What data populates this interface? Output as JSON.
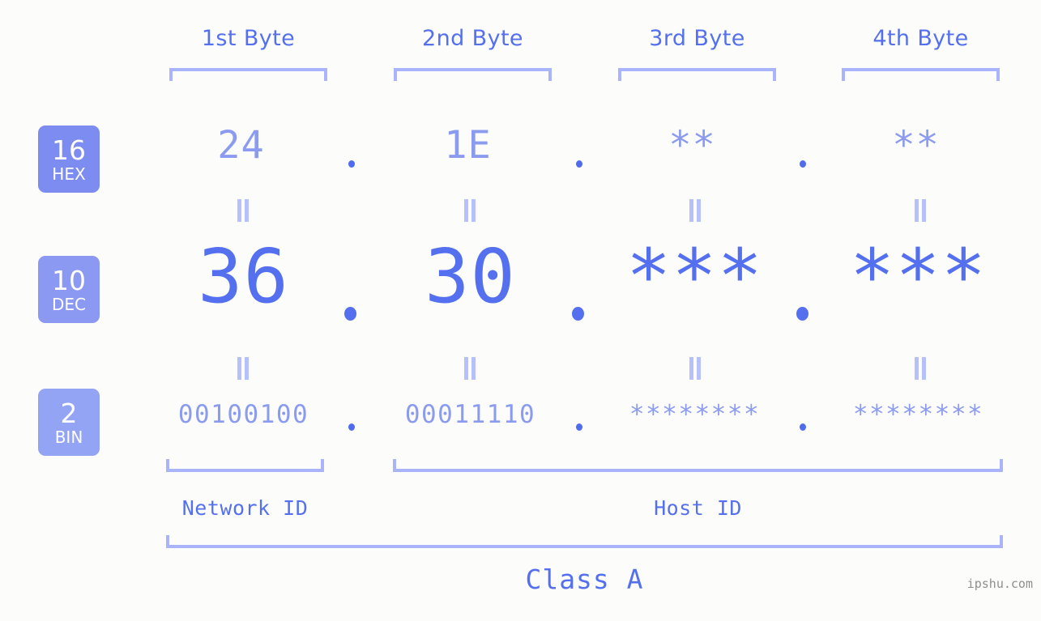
{
  "background_color": "#fcfdfa",
  "accent_strong": "#5570ef",
  "accent_light": "#8b9bf0",
  "bracket_color": "#aab4fb",
  "byte_headers": [
    {
      "label": "1st Byte"
    },
    {
      "label": "2nd Byte"
    },
    {
      "label": "3rd Byte"
    },
    {
      "label": "4th Byte"
    }
  ],
  "bases": [
    {
      "number": "16",
      "name": "HEX",
      "color": "#7c8cf0"
    },
    {
      "number": "10",
      "name": "DEC",
      "color": "#8b99f2"
    },
    {
      "number": "2",
      "name": "BIN",
      "color": "#94a4f5"
    }
  ],
  "rows": {
    "hex": {
      "values": [
        "24",
        "1E",
        "**",
        "**"
      ],
      "separator": "."
    },
    "dec": {
      "values": [
        "36",
        "30",
        "***",
        "***"
      ],
      "separator": "."
    },
    "bin": {
      "values": [
        "00100100",
        "00011110",
        "********",
        "********"
      ],
      "separator": "."
    }
  },
  "equals_marks": {
    "symbol": "=",
    "count_per_row": 4,
    "rows": 2
  },
  "id_labels": [
    {
      "text": "Network ID"
    },
    {
      "text": "Host ID"
    }
  ],
  "class_label": "Class A",
  "watermark": "ipshu.com"
}
